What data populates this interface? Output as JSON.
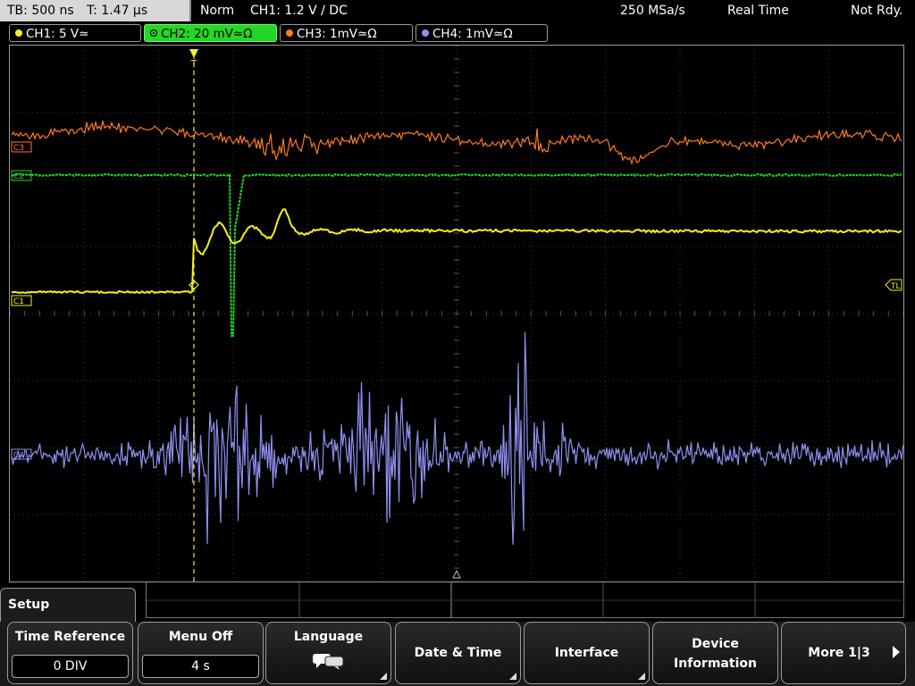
{
  "status": {
    "timebase": "TB: 500 ns",
    "trigger_time": "T: 1.47 µs",
    "mode": "Norm",
    "trigger": "CH1: 1.2 V ∕ DC",
    "sample_rate": "250 MSa/s",
    "acq_mode": "Real Time",
    "state": "Not Rdy."
  },
  "channels": [
    {
      "label": "CH1: 5 V≃",
      "color": "#f5f020"
    },
    {
      "label": "CH2: 20 mV≃Ω",
      "color": "#27d427"
    },
    {
      "label": "CH3: 1mV≃Ω",
      "color": "#ff7a1f"
    },
    {
      "label": "CH4: 1mV≃Ω",
      "color": "#8f8ff0"
    }
  ],
  "markers": {
    "c1": "C1",
    "c2": "C2",
    "c3": "C3",
    "c4": "C4",
    "trigger_level": "TL",
    "trigger_pos": "T"
  },
  "menu": {
    "title": "Setup",
    "keys": [
      {
        "label": "Time Reference",
        "value": "0 DIV"
      },
      {
        "label": "Menu Off",
        "value": "4 s"
      },
      {
        "label": "Language",
        "icon": "speech-bubbles-icon"
      },
      {
        "label": "Date & Time"
      },
      {
        "label": "Interface"
      },
      {
        "label": "Device",
        "label2": "Information"
      },
      {
        "label": "More 1|3"
      }
    ]
  }
}
